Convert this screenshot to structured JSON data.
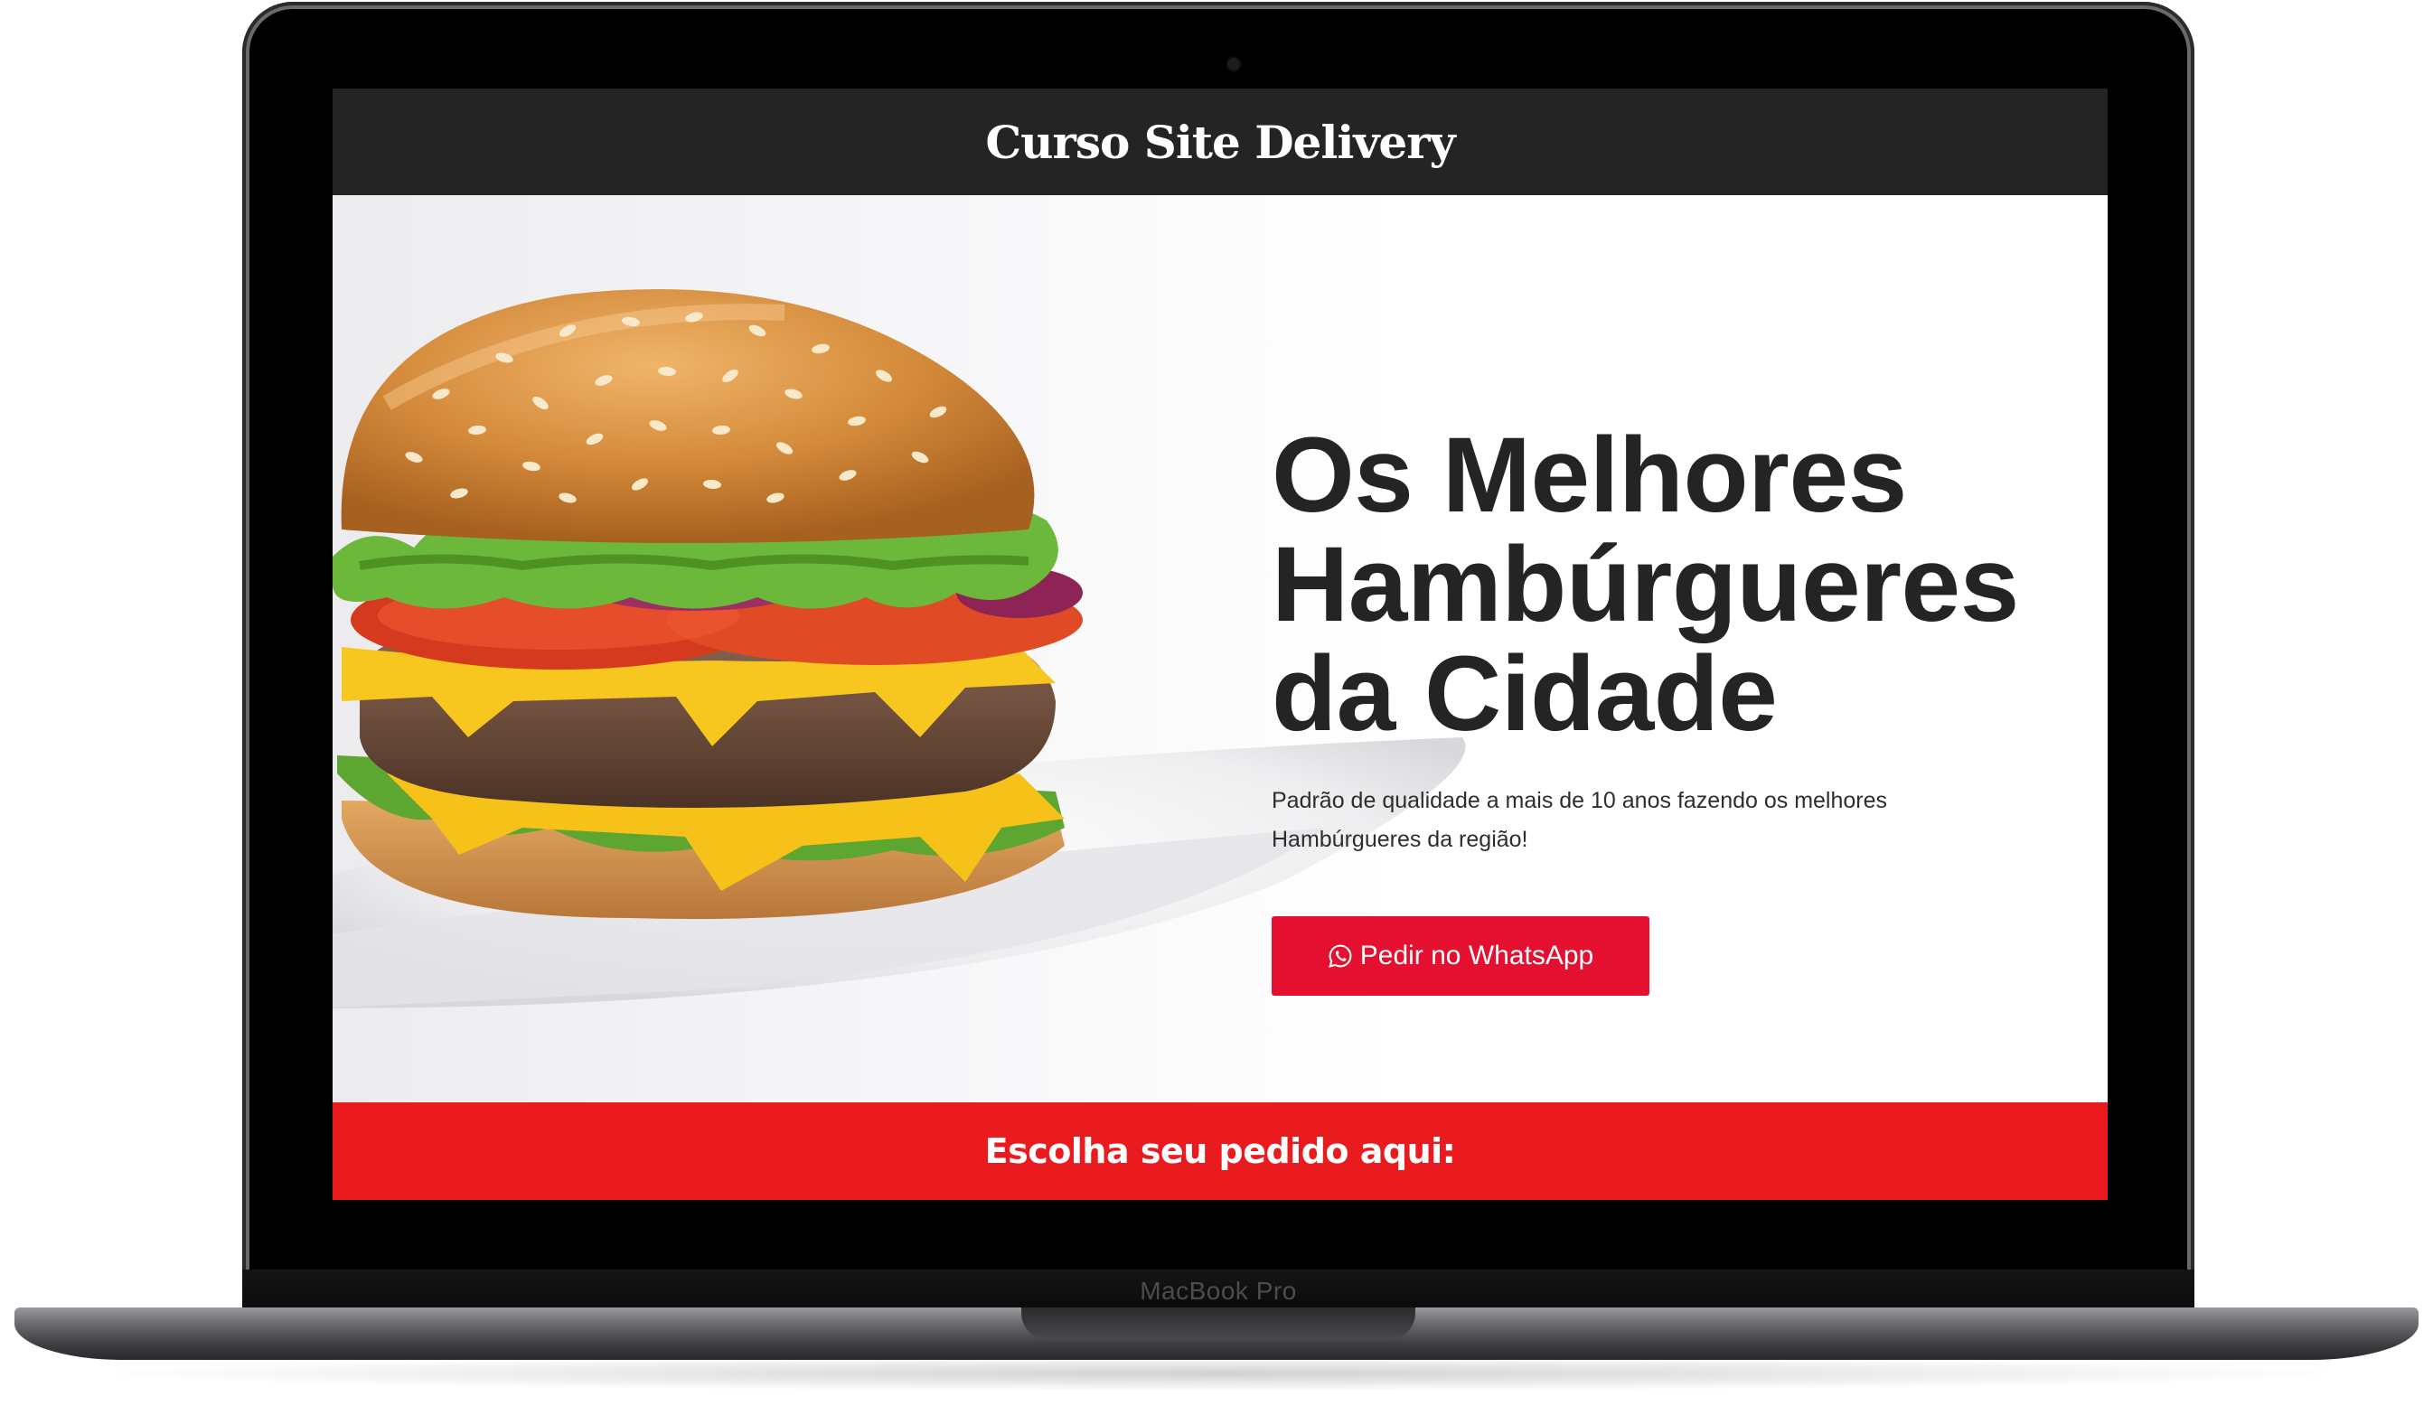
{
  "site": {
    "title": "Curso Site Delivery"
  },
  "hero": {
    "heading": "Os Melhores\nHambúrgueres\nda Cidade",
    "description": "Padrão de qualidade a mais de 10 anos fazendo os melhores Hambúrgueres da região!",
    "button_label": "Pedir no WhatsApp",
    "button_icon": "whatsapp-icon"
  },
  "banner": {
    "text": "Escolha seu pedido aqui:"
  },
  "device": {
    "label": "MacBook Pro"
  },
  "colors": {
    "header_bg": "#242424",
    "accent_red": "#e5102f",
    "banner_red": "#ea1b1e",
    "heading_text": "#242424"
  }
}
